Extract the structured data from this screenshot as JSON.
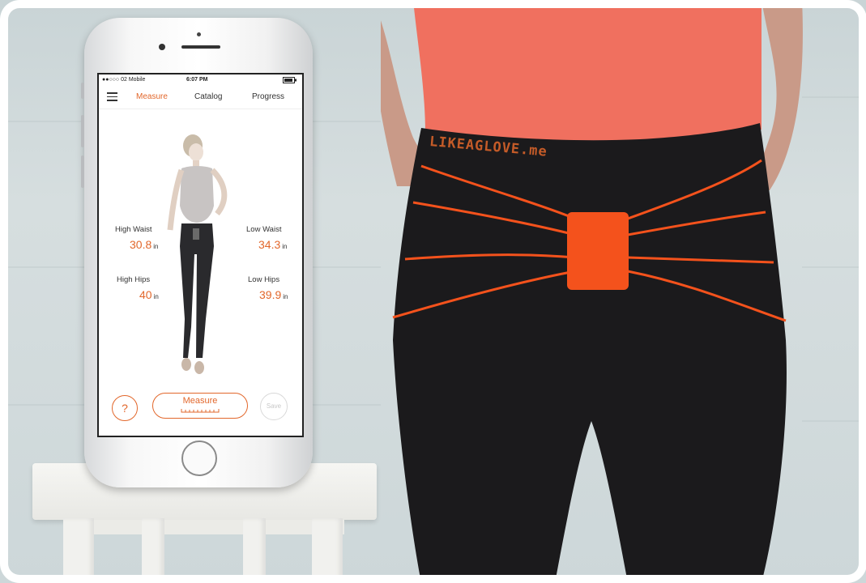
{
  "phone": {
    "status": {
      "carrier": "●●○○○ 02 Mobile",
      "time": "6:07 PM"
    },
    "nav": {
      "tabs": [
        {
          "label": "Measure",
          "active": true
        },
        {
          "label": "Catalog",
          "active": false
        },
        {
          "label": "Progress",
          "active": false
        }
      ]
    },
    "measurements": {
      "high_waist": {
        "label": "High Waist",
        "value": "30.8",
        "unit": "in"
      },
      "low_waist": {
        "label": "Low Waist",
        "value": "34.3",
        "unit": "in"
      },
      "high_hips": {
        "label": "High Hips",
        "value": "40",
        "unit": "in"
      },
      "low_hips": {
        "label": "Low Hips",
        "value": "39.9",
        "unit": "in"
      }
    },
    "buttons": {
      "help": "?",
      "measure": "Measure",
      "save": "Save"
    }
  },
  "product": {
    "brand_text": "LIKEAGLOVE.me"
  },
  "colors": {
    "accent": "#e2672b",
    "shirt": "#f0705f",
    "leggings": "#1b1a1c",
    "sensor": "#f4521c"
  }
}
